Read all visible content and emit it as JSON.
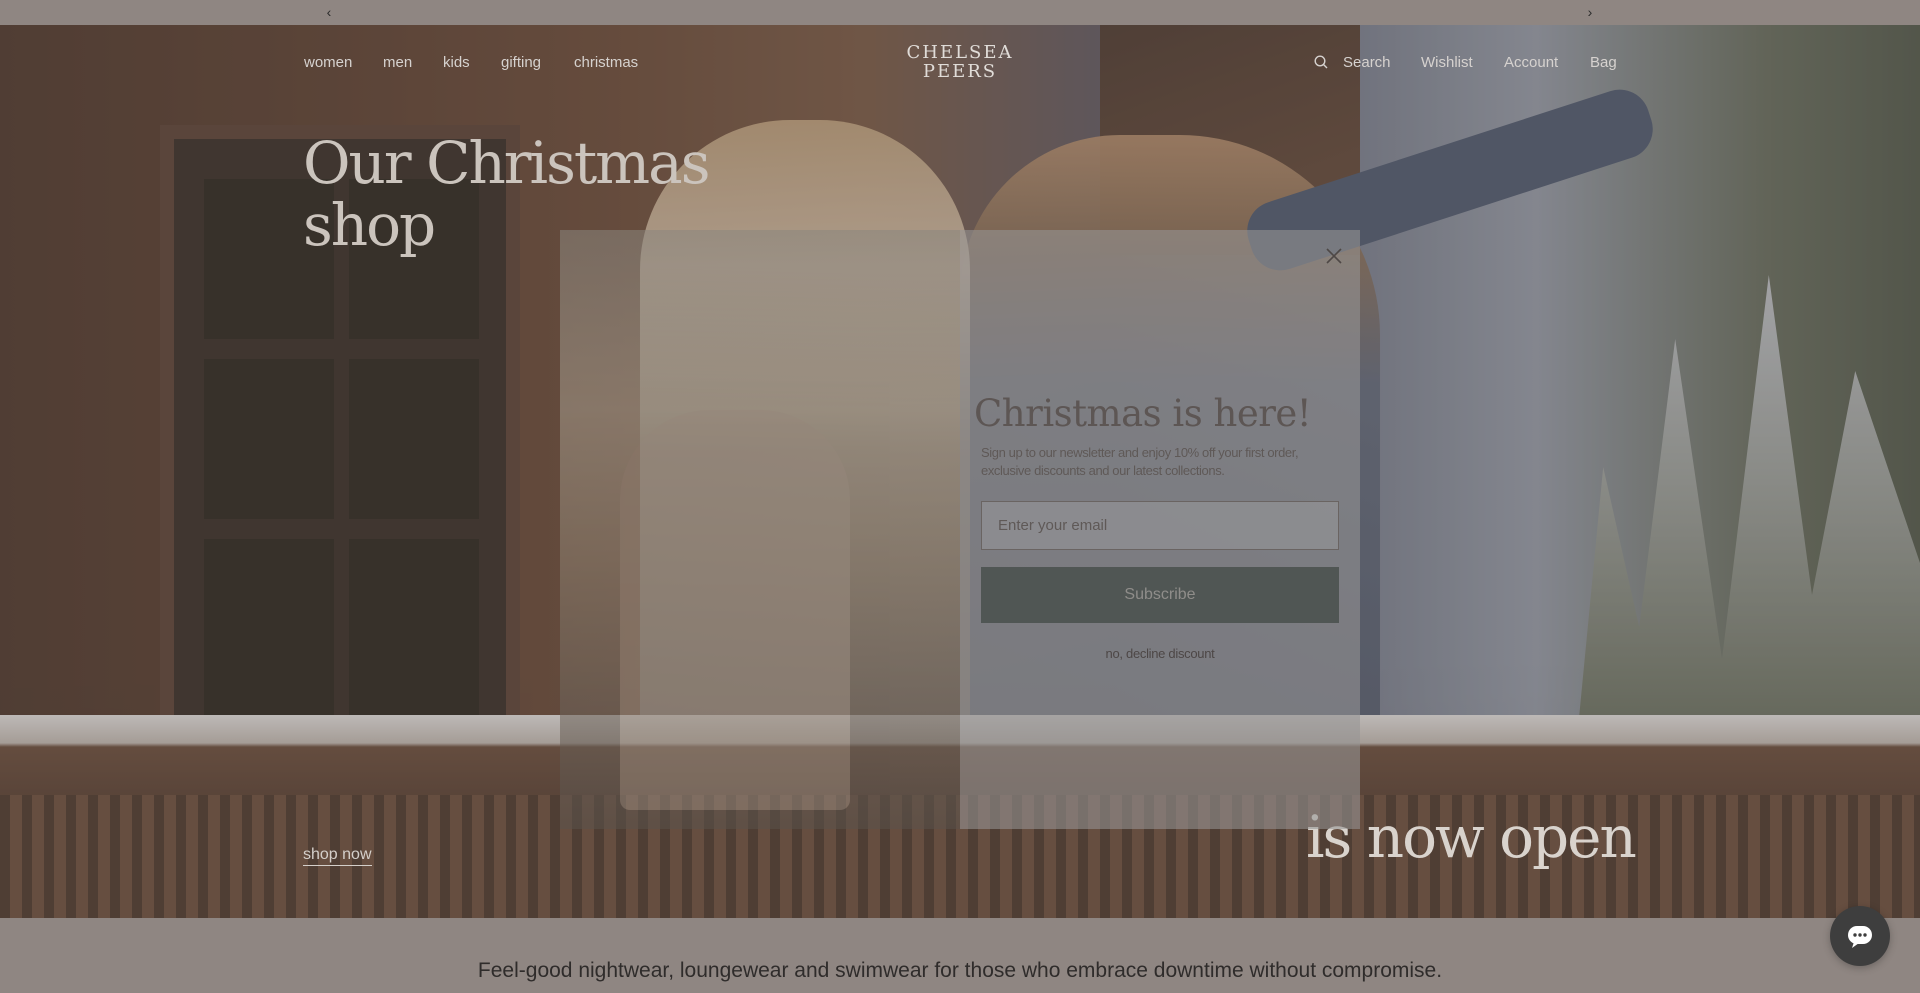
{
  "announcement": {
    "prev_icon": "chevron-left-icon",
    "next_icon": "chevron-right-icon"
  },
  "nav": {
    "left": [
      "women",
      "men",
      "kids",
      "gifting",
      "christmas"
    ],
    "logo_line1": "CHELSEA",
    "logo_line2": "PEERS",
    "search_label": "Search",
    "wishlist_label": "Wishlist",
    "account_label": "Account",
    "bag_label": "Bag"
  },
  "hero": {
    "title_line1": "Our Christmas",
    "title_line2": "shop",
    "subtitle": "is now open",
    "cta": "shop now"
  },
  "popup": {
    "title": "Christmas is here!",
    "body": "Sign up to our newsletter and enjoy 10% off your first order, exclusive discounts and our latest collections.",
    "email_placeholder": "Enter your email",
    "subscribe_label": "Subscribe",
    "decline_label": "no, decline discount"
  },
  "tagline": "Feel-good nightwear, loungewear and swimwear for those who embrace downtime without compromise.",
  "colors": {
    "overlay": "#8f8682",
    "button": "#505654"
  }
}
